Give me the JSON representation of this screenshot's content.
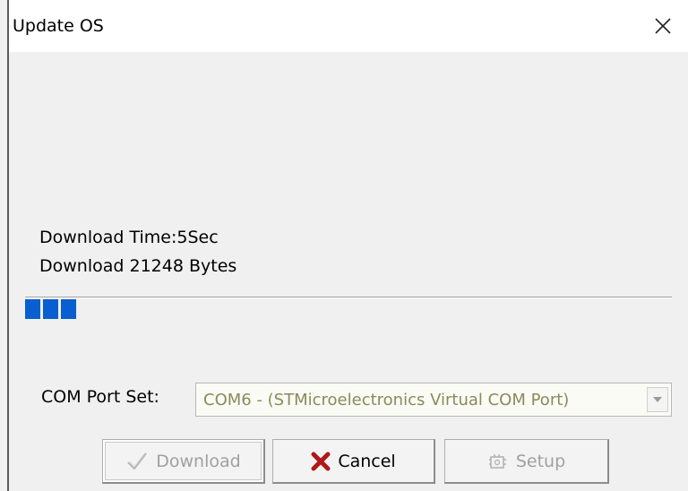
{
  "window": {
    "title": "Update OS",
    "close_icon": "close-icon"
  },
  "status": {
    "download_time": "Download Time:5Sec",
    "download_bytes": "Download 21248 Bytes",
    "progress_fraction": 0.09
  },
  "com_port": {
    "label": "COM Port Set:",
    "selected": "COM6 - (STMicroelectronics Virtual COM Port)",
    "dropdown_icon": "chevron-down-icon"
  },
  "buttons": {
    "download": {
      "label": "Download",
      "icon": "check-icon",
      "enabled": false
    },
    "cancel": {
      "label": "Cancel",
      "icon": "x-icon",
      "enabled": true
    },
    "setup": {
      "label": "Setup",
      "icon": "setup-icon",
      "enabled": false
    }
  },
  "colors": {
    "progress": "#0a5fd0",
    "cancel_icon": "#b01818",
    "disabled_text": "#a0a0a0"
  }
}
